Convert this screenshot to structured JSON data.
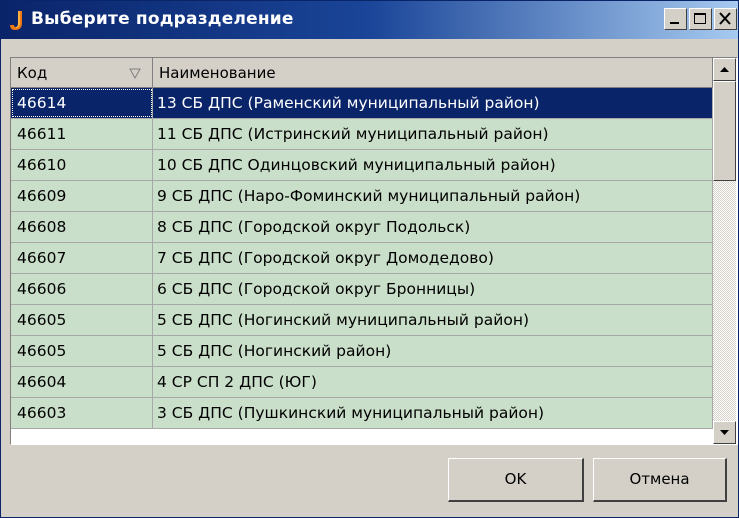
{
  "window": {
    "title": "Выберите подразделение",
    "title_bar_color": "#0a246a"
  },
  "titlebar_buttons": {
    "minimize_icon": "minimize-icon",
    "maximize_icon": "maximize-icon",
    "close_icon": "close-icon"
  },
  "grid": {
    "columns": [
      "Код",
      "Наименование"
    ],
    "sort_icon": "sort-descending-icon",
    "row_color": "#cadfca",
    "selected_color": "#0a246a",
    "rows": [
      {
        "code": "46614",
        "name": "13 СБ ДПС (Раменский муниципальный район)"
      },
      {
        "code": "46611",
        "name": "11 СБ ДПС (Истринский муниципальный район)"
      },
      {
        "code": "46610",
        "name": "10 СБ ДПС Одинцовский муниципальный район)"
      },
      {
        "code": "46609",
        "name": "9 СБ ДПС (Наро-Фоминский муниципальный район)"
      },
      {
        "code": "46608",
        "name": "8 СБ ДПС (Городской округ Подольск)"
      },
      {
        "code": "46607",
        "name": "7 СБ ДПС (Городской округ Домодедово)"
      },
      {
        "code": "46606",
        "name": "6 СБ ДПС (Городской округ Бронницы)"
      },
      {
        "code": "46605",
        "name": "5 СБ ДПС (Ногинский муниципальный район)"
      },
      {
        "code": "46605",
        "name": "5 СБ ДПС (Ногинский район)"
      },
      {
        "code": "46604",
        "name": "4 СР СП 2 ДПС (ЮГ)"
      },
      {
        "code": "46603",
        "name": "3 СБ ДПС (Пушкинский  муниципальный район)"
      }
    ]
  },
  "buttons": {
    "ok_label": "OK",
    "cancel_label": "Отмена"
  }
}
